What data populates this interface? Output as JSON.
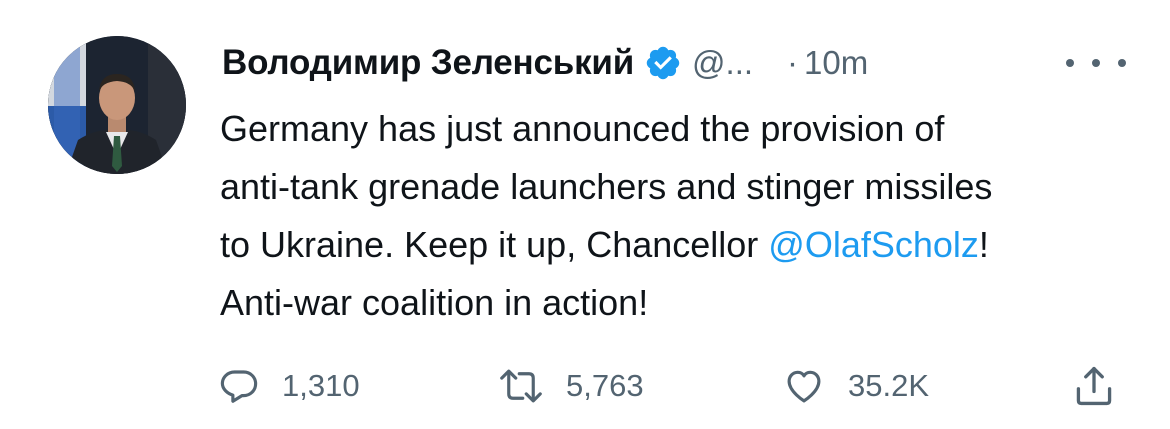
{
  "author": {
    "name": "Володимир Зеленський",
    "handle": "@...",
    "verified": true,
    "avatar_icon": "profile-photo"
  },
  "meta": {
    "separator": "·",
    "time": "10m"
  },
  "body": {
    "line1": "Germany has just announced the provision of",
    "line2": "anti-tank grenade launchers and stinger missiles",
    "line3_prefix": "to Ukraine. Keep it up, Chancellor ",
    "mention": "@OlafScholz",
    "line3_suffix": "!",
    "line4": "Anti-war coalition in action!"
  },
  "actions": {
    "replies": "1,310",
    "retweets": "5,763",
    "likes": "35.2K",
    "share_icon": "share-icon"
  },
  "colors": {
    "text": "#0f1419",
    "muted": "#536471",
    "accent": "#1d9bf0"
  }
}
